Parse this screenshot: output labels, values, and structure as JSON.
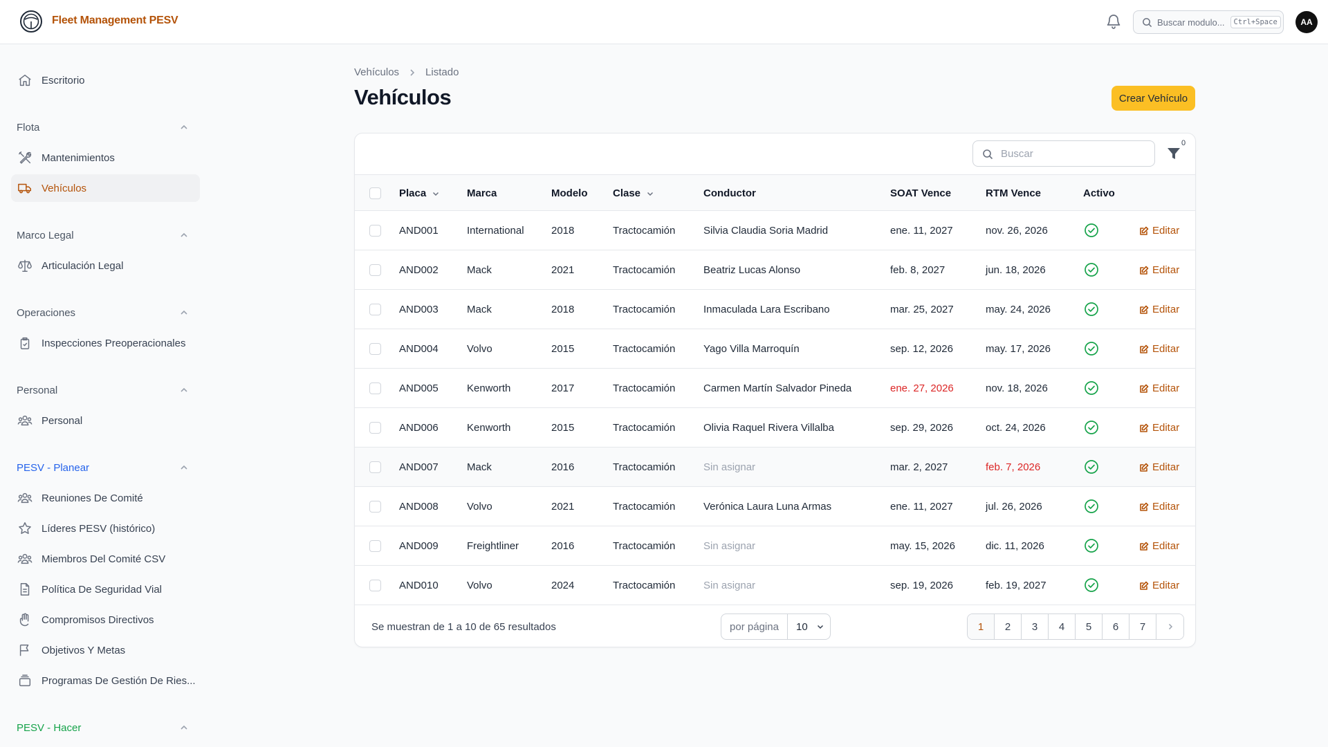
{
  "app": {
    "title": "Fleet Management PESV"
  },
  "topbar": {
    "search_placeholder": "Buscar modulo...",
    "shortcut": "Ctrl+Space",
    "avatar_initials": "AA"
  },
  "sidebar": {
    "dashboard": "Escritorio",
    "groups": [
      {
        "label": "Flota",
        "items": [
          "Mantenimientos",
          "Vehículos"
        ]
      },
      {
        "label": "Marco Legal",
        "items": [
          "Articulación Legal"
        ]
      },
      {
        "label": "Operaciones",
        "items": [
          "Inspecciones Preoperacionales"
        ]
      },
      {
        "label": "Personal",
        "items": [
          "Personal"
        ]
      },
      {
        "label": "PESV - Planear",
        "items": [
          "Reuniones De Comité",
          "Líderes PESV (histórico)",
          "Miembros Del Comité CSV",
          "Política De Seguridad Vial",
          "Compromisos Directivos",
          "Objetivos Y Metas",
          "Programas De Gestión De Ries..."
        ]
      },
      {
        "label": "PESV - Hacer",
        "items": []
      }
    ],
    "active_item": "Vehículos"
  },
  "breadcrumb": [
    "Vehículos",
    "Listado"
  ],
  "page": {
    "title": "Vehículos",
    "create_label": "Crear Vehículo"
  },
  "table": {
    "search_placeholder": "Buscar",
    "filter_count": "0",
    "columns": [
      "Placa",
      "Marca",
      "Modelo",
      "Clase",
      "Conductor",
      "SOAT Vence",
      "RTM Vence",
      "Activo"
    ],
    "edit_label": "Editar",
    "rows": [
      {
        "placa": "AND001",
        "marca": "International",
        "modelo": "2018",
        "clase": "Tractocamión",
        "conductor": "Silvia Claudia Soria Madrid",
        "soat": "ene. 11, 2027",
        "rtm": "nov. 26, 2026",
        "activo": true
      },
      {
        "placa": "AND002",
        "marca": "Mack",
        "modelo": "2021",
        "clase": "Tractocamión",
        "conductor": "Beatriz Lucas Alonso",
        "soat": "feb. 8, 2027",
        "rtm": "jun. 18, 2026",
        "activo": true
      },
      {
        "placa": "AND003",
        "marca": "Mack",
        "modelo": "2018",
        "clase": "Tractocamión",
        "conductor": "Inmaculada Lara Escribano",
        "soat": "mar. 25, 2027",
        "rtm": "may. 24, 2026",
        "activo": true
      },
      {
        "placa": "AND004",
        "marca": "Volvo",
        "modelo": "2015",
        "clase": "Tractocamión",
        "conductor": "Yago Villa Marroquín",
        "soat": "sep. 12, 2026",
        "rtm": "may. 17, 2026",
        "activo": true
      },
      {
        "placa": "AND005",
        "marca": "Kenworth",
        "modelo": "2017",
        "clase": "Tractocamión",
        "conductor": "Carmen Martín Salvador Pineda",
        "soat": "ene. 27, 2026",
        "rtm": "nov. 18, 2026",
        "activo": true,
        "soat_expired": true
      },
      {
        "placa": "AND006",
        "marca": "Kenworth",
        "modelo": "2015",
        "clase": "Tractocamión",
        "conductor": "Olivia Raquel Rivera Villalba",
        "soat": "sep. 29, 2026",
        "rtm": "oct. 24, 2026",
        "activo": true
      },
      {
        "placa": "AND007",
        "marca": "Mack",
        "modelo": "2016",
        "clase": "Tractocamión",
        "conductor": "Sin asignar",
        "soat": "mar. 2, 2027",
        "rtm": "feb. 7, 2026",
        "activo": true,
        "rtm_expired": true,
        "unassigned": true
      },
      {
        "placa": "AND008",
        "marca": "Volvo",
        "modelo": "2021",
        "clase": "Tractocamión",
        "conductor": "Verónica Laura Luna Armas",
        "soat": "ene. 11, 2027",
        "rtm": "jul. 26, 2026",
        "activo": true
      },
      {
        "placa": "AND009",
        "marca": "Freightliner",
        "modelo": "2016",
        "clase": "Tractocamión",
        "conductor": "Sin asignar",
        "soat": "may. 15, 2026",
        "rtm": "dic. 11, 2026",
        "activo": true,
        "unassigned": true
      },
      {
        "placa": "AND010",
        "marca": "Volvo",
        "modelo": "2024",
        "clase": "Tractocamión",
        "conductor": "Sin asignar",
        "soat": "sep. 19, 2026",
        "rtm": "feb. 19, 2027",
        "activo": true,
        "unassigned": true
      }
    ]
  },
  "footer": {
    "summary": "Se muestran de 1 a 10 de 65 resultados",
    "per_page_label": "por página",
    "per_page_value": "10",
    "pages": [
      "1",
      "2",
      "3",
      "4",
      "5",
      "6",
      "7"
    ],
    "current_page": "1"
  },
  "colors": {
    "brand": "#b45309",
    "accent": "#fbbf24",
    "danger": "#dc2626",
    "success": "#16a34a",
    "link": "#2563eb"
  }
}
